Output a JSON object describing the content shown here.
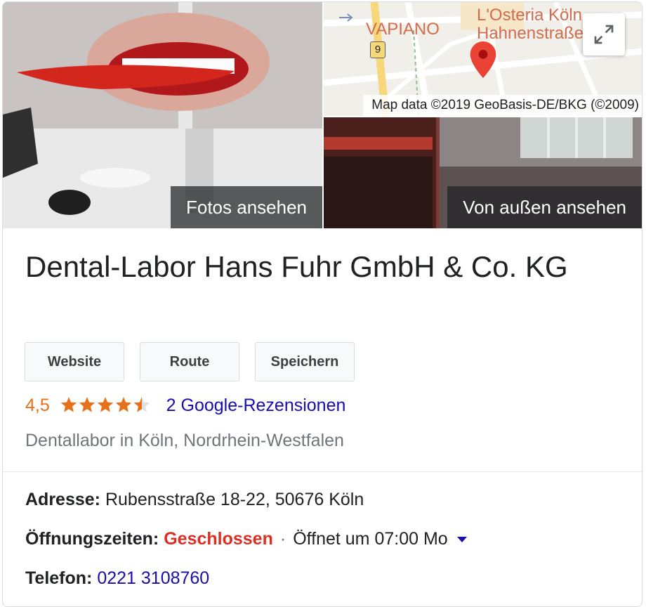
{
  "photos": {
    "main_label": "Fotos ansehen",
    "front_label": "Von außen ansehen"
  },
  "map": {
    "label_vapiano": "VAPIANO",
    "label_osteria_line1": "L'Osteria Köln",
    "label_osteria_line2": "Hahnenstraße",
    "road_badge": "9",
    "credit": "Map data ©2019 GeoBasis-DE/BKG (©2009)"
  },
  "business": {
    "name": "Dental-Labor Hans Fuhr GmbH & Co. KG",
    "category": "Dentallabor in Köln, Nordrhein-Westfalen"
  },
  "actions": {
    "website": "Website",
    "route": "Route",
    "save": "Speichern"
  },
  "rating": {
    "value_text": "4,5",
    "value": 4.5,
    "max": 5,
    "reviews_text": "2 Google-Rezensionen"
  },
  "details": {
    "address_label": "Adresse:",
    "address_value": "Rubensstraße 18-22, 50676 Köln",
    "hours_label": "Öffnungszeiten:",
    "hours_status": "Geschlossen",
    "hours_sep": "·",
    "hours_next": "Öffnet um 07:00 Mo",
    "phone_label": "Telefon:",
    "phone_value": "0221 3108760"
  },
  "colors": {
    "star": "#e7711b",
    "link": "#1a0dab",
    "closed": "#d93025",
    "map_pin": "#ea4335"
  },
  "icons": {
    "expand": "expand-icon",
    "star": "star-icon",
    "dropdown": "caret-down-icon",
    "pin": "map-pin-icon"
  }
}
